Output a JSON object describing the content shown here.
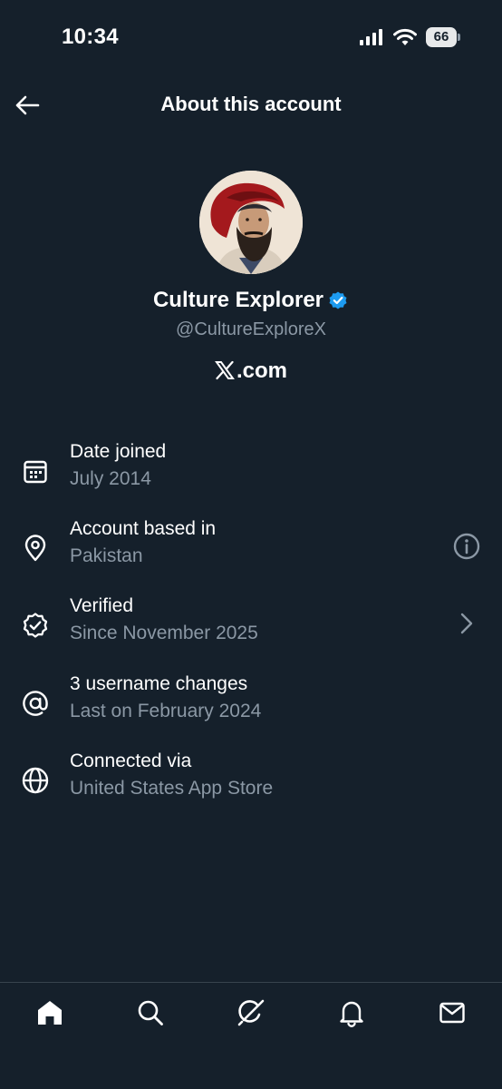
{
  "status_bar": {
    "time": "10:34",
    "battery_level": "66"
  },
  "header": {
    "title": "About this account"
  },
  "profile": {
    "display_name": "Culture Explorer",
    "handle": "@CultureExploreX",
    "source_suffix": ".com",
    "verified_badge_color": "#1d9bf0"
  },
  "info_items": [
    {
      "icon": "calendar-icon",
      "title": "Date joined",
      "subtitle": "July 2014"
    },
    {
      "icon": "location-pin-icon",
      "title": "Account based in",
      "subtitle": "Pakistan",
      "trailing": "info-icon"
    },
    {
      "icon": "verified-badge-icon",
      "title": "Verified",
      "subtitle": "Since November 2025",
      "trailing": "chevron-right-icon"
    },
    {
      "icon": "at-sign-icon",
      "title": "3 username changes",
      "subtitle": "Last on February 2024"
    },
    {
      "icon": "globe-icon",
      "title": "Connected via",
      "subtitle": "United States App Store"
    }
  ],
  "bottom_nav": [
    "home-icon",
    "search-icon",
    "grok-icon",
    "notifications-icon",
    "messages-icon"
  ],
  "colors": {
    "background": "#15202b",
    "text_secondary": "#8b98a5",
    "accent": "#1d9bf0"
  }
}
